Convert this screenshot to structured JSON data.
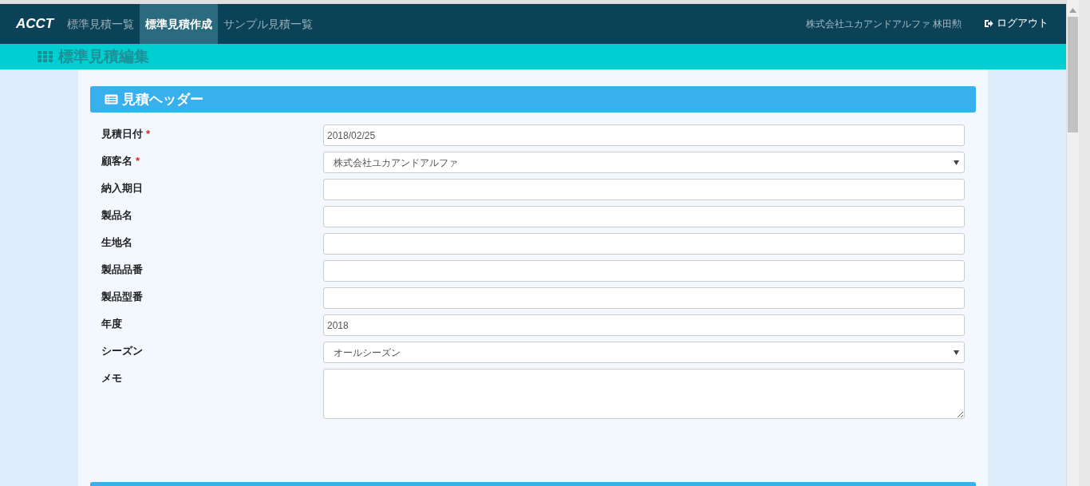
{
  "navbar": {
    "brand": "ACCT",
    "tabs": [
      {
        "label": "標準見積一覧",
        "selected": false
      },
      {
        "label": "標準見積作成",
        "selected": true
      },
      {
        "label": "サンプル見積一覧",
        "selected": false
      }
    ],
    "user": "株式会社ユカアンドアルファ 林田勲",
    "logout": "ログアウト"
  },
  "page_title": "標準見積編集",
  "panel": {
    "title": "見積ヘッダー",
    "fields": [
      {
        "kind": "text",
        "label": "見積日付",
        "required_mark": "*",
        "value": "2018/02/25"
      },
      {
        "kind": "select",
        "label": "顧客名",
        "required_mark": "*",
        "value": "株式会社ユカアンドアルファ"
      },
      {
        "kind": "text",
        "label": "納入期日"
      },
      {
        "kind": "text",
        "label": "製品名"
      },
      {
        "kind": "text",
        "label": "生地名"
      },
      {
        "kind": "text",
        "label": "製品品番"
      },
      {
        "kind": "text",
        "label": "製品型番"
      },
      {
        "kind": "text",
        "label": "年度",
        "value": "2018"
      },
      {
        "kind": "select",
        "label": "シーズン",
        "value": "オールシーズン"
      },
      {
        "kind": "textarea",
        "label": "メモ"
      }
    ]
  }
}
